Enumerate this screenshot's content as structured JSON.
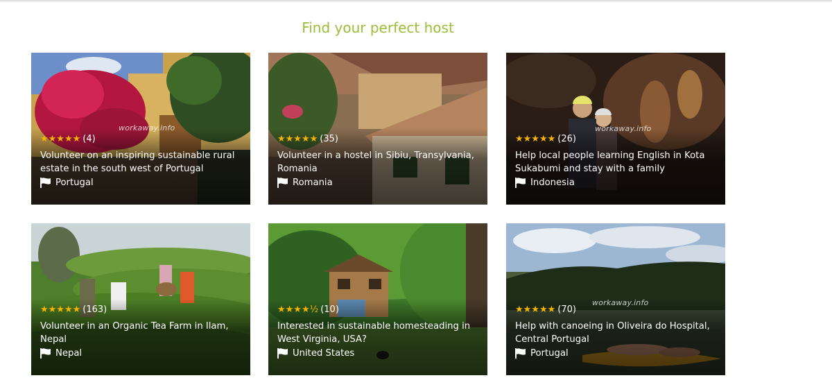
{
  "heading": "Find your perfect host",
  "watermark": "workaway.info",
  "star_color": "#f4b400",
  "heading_color": "#9bbd3a",
  "cards": [
    {
      "rating": 5,
      "stars": "★★★★★",
      "count": "(4)",
      "title": "Volunteer on an inspiring sustainable rural estate in the south west of Portugal",
      "country": "Portugal"
    },
    {
      "rating": 5,
      "stars": "★★★★★",
      "count": "(35)",
      "title": "Volunteer in a hostel in Sibiu, Transylvania, Romania",
      "country": "Romania"
    },
    {
      "rating": 5,
      "stars": "★★★★★",
      "count": "(26)",
      "title": "Help local people learning English in Kota Sukabumi and stay with a family",
      "country": "Indonesia"
    },
    {
      "rating": 5,
      "stars": "★★★★★",
      "count": "(163)",
      "title": "Volunteer in an Organic Tea Farm in Ilam, Nepal",
      "country": "Nepal"
    },
    {
      "rating": 4.5,
      "stars": "★★★★½",
      "count": "(10)",
      "title": "Interested in sustainable homesteading in West Virginia, USA?",
      "country": "United States"
    },
    {
      "rating": 5,
      "stars": "★★★★★",
      "count": "(70)",
      "title": "Help with canoeing in Oliveira do Hospital, Central Portugal",
      "country": "Portugal"
    }
  ]
}
